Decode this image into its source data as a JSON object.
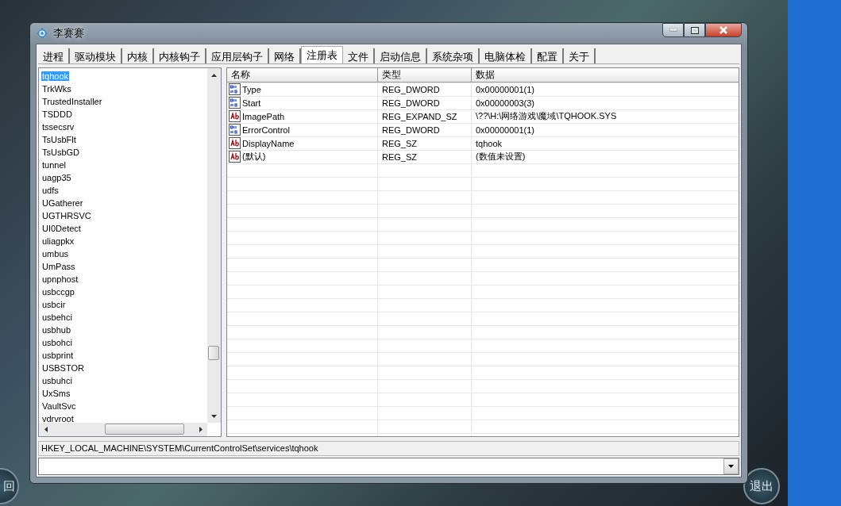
{
  "window": {
    "title": "李赛赛"
  },
  "tabs": [
    {
      "label": "进程",
      "selected": false
    },
    {
      "label": "驱动模块",
      "selected": false
    },
    {
      "label": "内核",
      "selected": false
    },
    {
      "label": "内核钩子",
      "selected": false
    },
    {
      "label": "应用层钩子",
      "selected": false
    },
    {
      "label": "网络",
      "selected": false
    },
    {
      "label": "注册表",
      "selected": true
    },
    {
      "label": "文件",
      "selected": false
    },
    {
      "label": "启动信息",
      "selected": false
    },
    {
      "label": "系统杂项",
      "selected": false
    },
    {
      "label": "电脑体检",
      "selected": false
    },
    {
      "label": "配置",
      "selected": false
    },
    {
      "label": "关于",
      "selected": false
    }
  ],
  "key_list": {
    "items": [
      {
        "name": "tqhook",
        "selected": true
      },
      {
        "name": "TrkWks",
        "selected": false
      },
      {
        "name": "TrustedInstaller",
        "selected": false
      },
      {
        "name": "TSDDD",
        "selected": false
      },
      {
        "name": "tssecsrv",
        "selected": false
      },
      {
        "name": "TsUsbFlt",
        "selected": false
      },
      {
        "name": "TsUsbGD",
        "selected": false
      },
      {
        "name": "tunnel",
        "selected": false
      },
      {
        "name": "uagp35",
        "selected": false
      },
      {
        "name": "udfs",
        "selected": false
      },
      {
        "name": "UGatherer",
        "selected": false
      },
      {
        "name": "UGTHRSVC",
        "selected": false
      },
      {
        "name": "UI0Detect",
        "selected": false
      },
      {
        "name": "uliagpkx",
        "selected": false
      },
      {
        "name": "umbus",
        "selected": false
      },
      {
        "name": "UmPass",
        "selected": false
      },
      {
        "name": "upnphost",
        "selected": false
      },
      {
        "name": "usbccgp",
        "selected": false
      },
      {
        "name": "usbcir",
        "selected": false
      },
      {
        "name": "usbehci",
        "selected": false
      },
      {
        "name": "usbhub",
        "selected": false
      },
      {
        "name": "usbohci",
        "selected": false
      },
      {
        "name": "usbprint",
        "selected": false
      },
      {
        "name": "USBSTOR",
        "selected": false
      },
      {
        "name": "usbuhci",
        "selected": false
      },
      {
        "name": "UxSms",
        "selected": false
      },
      {
        "name": "VaultSvc",
        "selected": false
      },
      {
        "name": "vdrvroot",
        "selected": false
      }
    ]
  },
  "values_table": {
    "columns": [
      "名称",
      "类型",
      "数据"
    ],
    "rows": [
      {
        "kind": "dword",
        "name": "Type",
        "type": "REG_DWORD",
        "data": "0x00000001(1)"
      },
      {
        "kind": "dword",
        "name": "Start",
        "type": "REG_DWORD",
        "data": "0x00000003(3)"
      },
      {
        "kind": "string",
        "name": "ImagePath",
        "type": "REG_EXPAND_SZ",
        "data": "\\??\\H:\\网络游戏\\魔域\\TQHOOK.SYS"
      },
      {
        "kind": "dword",
        "name": "ErrorControl",
        "type": "REG_DWORD",
        "data": "0x00000001(1)"
      },
      {
        "kind": "string",
        "name": "DisplayName",
        "type": "REG_SZ",
        "data": "tqhook"
      },
      {
        "kind": "string",
        "name": "(默认)",
        "type": "REG_SZ",
        "data": "(数值未设置)"
      }
    ]
  },
  "status_bar": {
    "path": "HKEY_LOCAL_MACHINE\\SYSTEM\\CurrentControlSet\\services\\tqhook"
  },
  "background_buttons": [
    {
      "label": "回"
    },
    {
      "label": "退出"
    }
  ]
}
